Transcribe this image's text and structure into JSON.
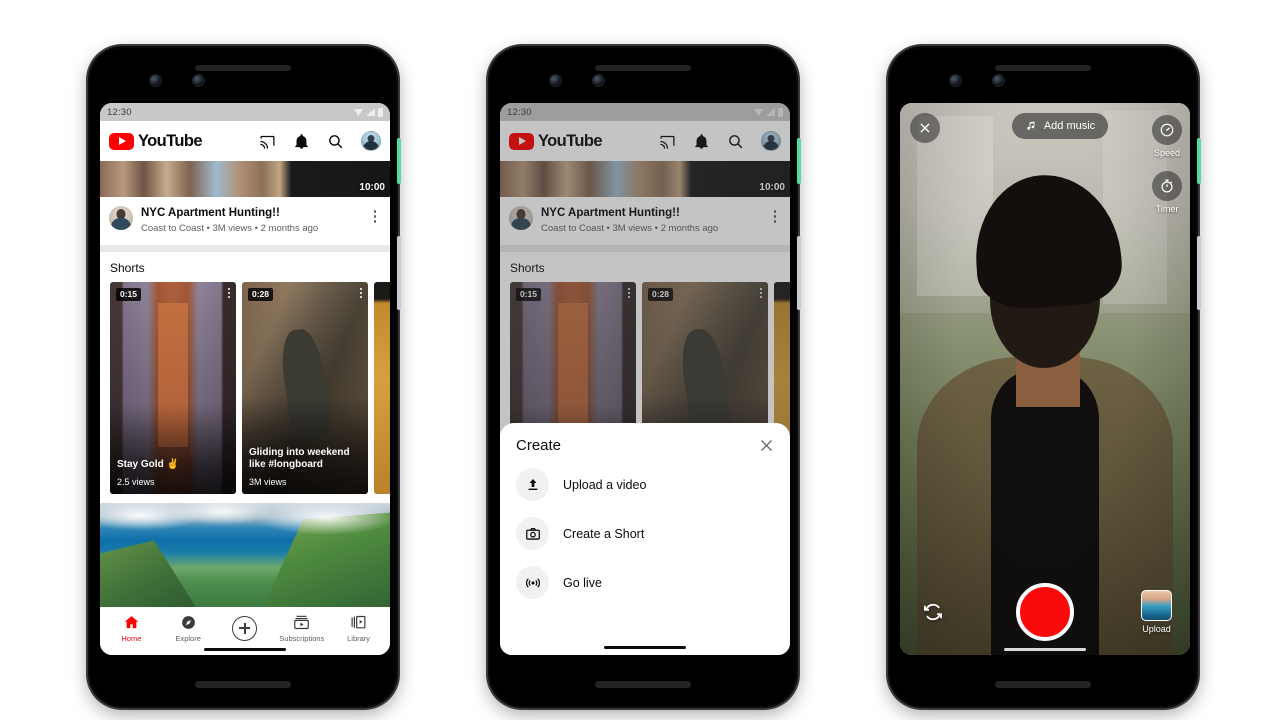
{
  "status_bar": {
    "clock": "12:30",
    "icons": [
      "wifi-icon",
      "signal-icon",
      "battery-icon"
    ]
  },
  "header": {
    "logo_text": "YouTube",
    "actions": [
      {
        "name": "cast-icon",
        "label": "Cast"
      },
      {
        "name": "bell-icon",
        "label": "Notifications"
      },
      {
        "name": "search-icon",
        "label": "Search"
      },
      {
        "name": "avatar",
        "label": "Account"
      }
    ]
  },
  "feed": {
    "video": {
      "duration": "10:00",
      "title": "NYC Apartment Hunting!!",
      "meta": "Coast to Coast • 3M views • 2 months ago"
    },
    "shorts_section_title": "Shorts",
    "shorts": [
      {
        "duration": "0:15",
        "title": "Stay Gold ✌️",
        "views": "2.5 views"
      },
      {
        "duration": "0:28",
        "title": "Gliding into weekend like #longboard",
        "views": "3M views"
      }
    ]
  },
  "bottom_nav": {
    "items": [
      {
        "icon": "home-icon",
        "label": "Home",
        "active": true
      },
      {
        "icon": "compass-icon",
        "label": "Explore",
        "active": false
      },
      {
        "icon": "plus-icon",
        "label": "",
        "active": false
      },
      {
        "icon": "subscriptions-icon",
        "label": "Subscriptions",
        "active": false
      },
      {
        "icon": "library-icon",
        "label": "Library",
        "active": false
      }
    ]
  },
  "create_sheet": {
    "title": "Create",
    "close_icon": "close-icon",
    "items": [
      {
        "icon": "upload-icon",
        "label": "Upload a video"
      },
      {
        "icon": "camera-icon",
        "label": "Create a Short"
      },
      {
        "icon": "broadcast-icon",
        "label": "Go live"
      }
    ]
  },
  "camera": {
    "close_icon": "close-icon",
    "add_music_label": "Add music",
    "music_icon": "music-note-icon",
    "tools": [
      {
        "icon": "speed-icon",
        "label": "Speed"
      },
      {
        "icon": "timer-icon",
        "label": "Timer"
      }
    ],
    "flip_icon": "flip-camera-icon",
    "record_button_label": "Record",
    "upload_label": "Upload",
    "record_color": "#fa0b0b"
  },
  "colors": {
    "brand_red": "#ff0000",
    "record_red": "#fa0b0b",
    "text_primary": "#0b0b0b",
    "text_secondary": "#606060",
    "power_button_green": "#5ad9a0"
  }
}
